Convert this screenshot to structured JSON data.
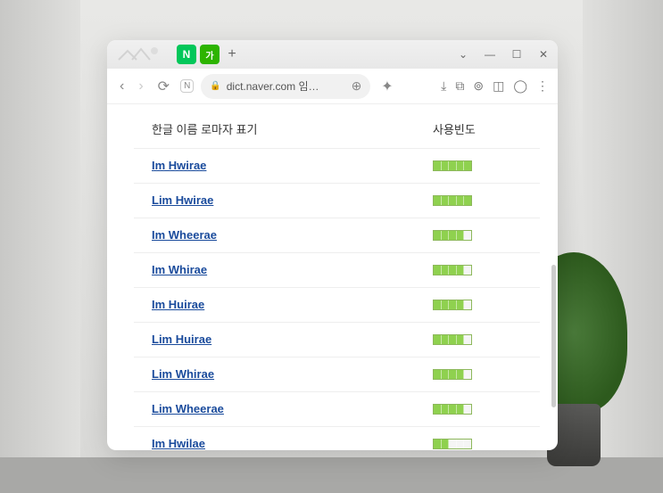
{
  "titlebar": {
    "tab_n": "N",
    "tab_g": "가",
    "new_tab": "+",
    "chevron": "⌄",
    "minimize": "—",
    "maximize": "☐",
    "close": "✕"
  },
  "toolbar": {
    "back": "‹",
    "forward": "›",
    "reload": "⟳",
    "app": "N",
    "lock": "🔒",
    "url": "dict.naver.com 임…",
    "zoom": "⊕",
    "star": "✦",
    "download": "⤓",
    "copy": "⧉",
    "lens": "⊚",
    "reader": "◫",
    "profile": "◯",
    "menu": "⋮"
  },
  "headers": {
    "name": "한글 이름 로마자 표기",
    "freq": "사용빈도"
  },
  "rows": [
    {
      "name": "Im Hwirae",
      "freq": 5
    },
    {
      "name": "Lim Hwirae",
      "freq": 5
    },
    {
      "name": "Im Wheerae",
      "freq": 4
    },
    {
      "name": "Im Whirae",
      "freq": 4
    },
    {
      "name": "Im Huirae",
      "freq": 4
    },
    {
      "name": "Lim Huirae",
      "freq": 4
    },
    {
      "name": "Lim Whirae",
      "freq": 4
    },
    {
      "name": "Lim Wheerae",
      "freq": 4
    },
    {
      "name": "Im Hwilae",
      "freq": 2
    }
  ]
}
